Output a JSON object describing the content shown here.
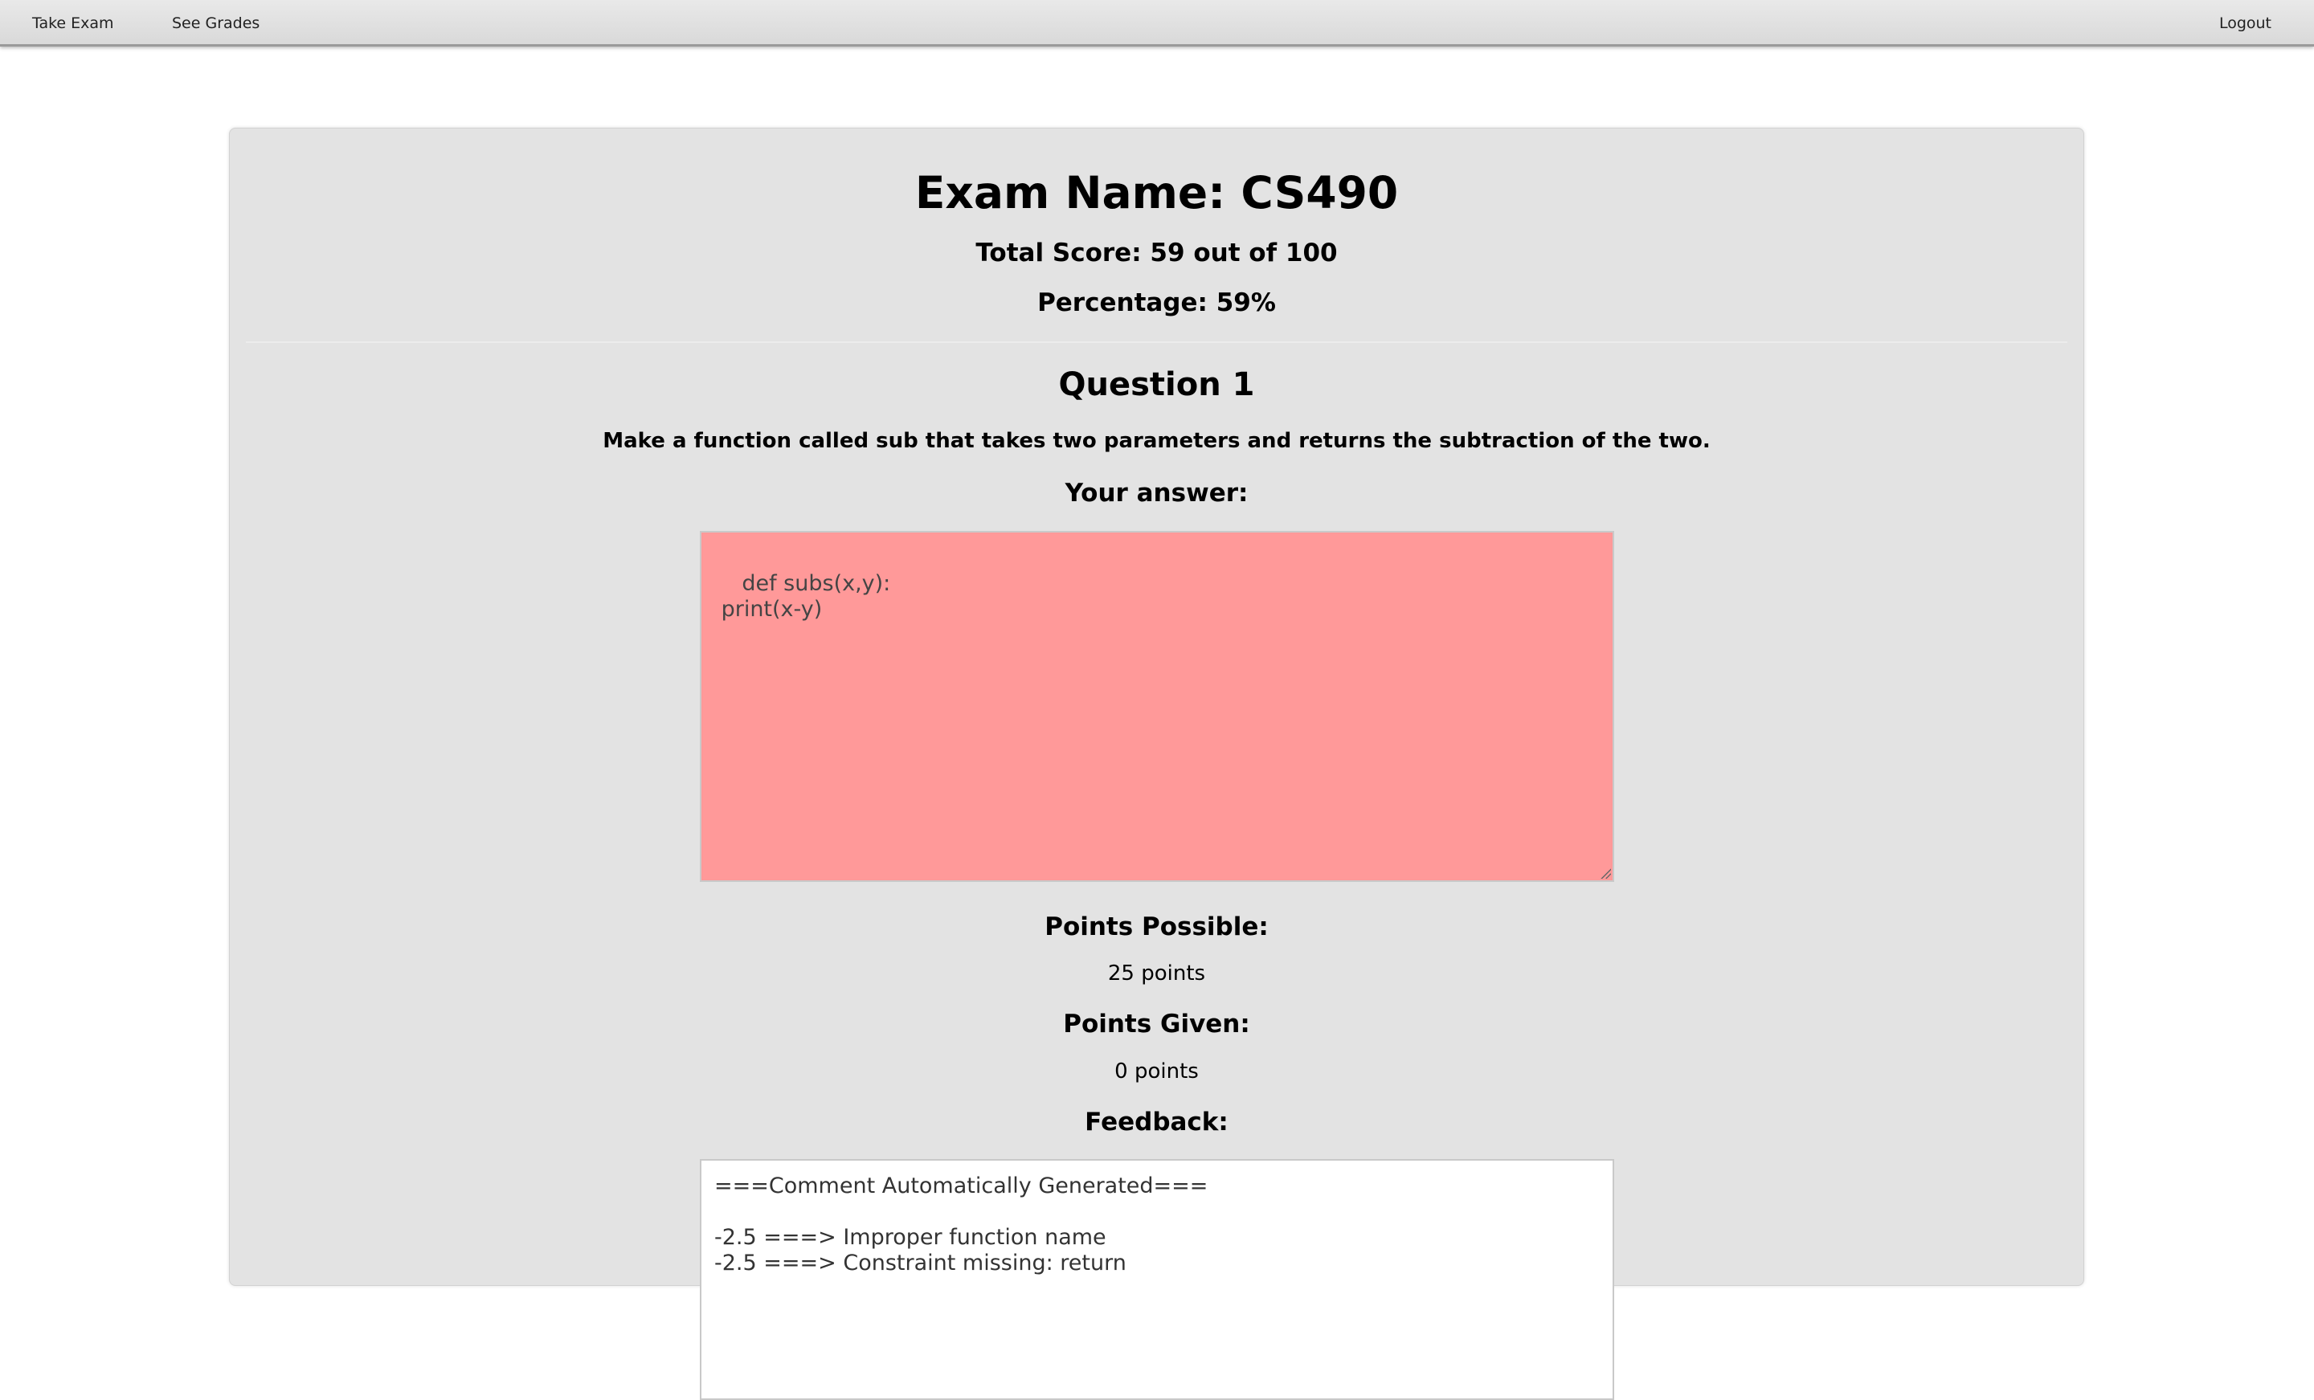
{
  "nav": {
    "take_exam": "Take Exam",
    "see_grades": "See Grades",
    "logout": "Logout"
  },
  "exam": {
    "name": "Exam Name: CS490",
    "total_score": "Total Score: 59 out of 100",
    "percentage": "Percentage: 59%"
  },
  "question": {
    "title": "Question 1",
    "prompt": "Make a function called sub that takes two parameters and returns the subtraction of the two.",
    "answer_label": "Your answer:",
    "answer_text": "def subs(x,y):\n print(x-y)",
    "points_possible_label": "Points Possible:",
    "points_possible": "25 points",
    "points_given_label": "Points Given:",
    "points_given": "0 points",
    "feedback_label": "Feedback:",
    "feedback_lines": [
      "===Comment Automatically Generated===",
      "",
      "-2.5 ===> Improper function name",
      "-2.5 ===> Constraint missing: return"
    ]
  },
  "colors": {
    "answer_incorrect_bg": "#ff9999",
    "card_bg": "#e3e3e3"
  }
}
